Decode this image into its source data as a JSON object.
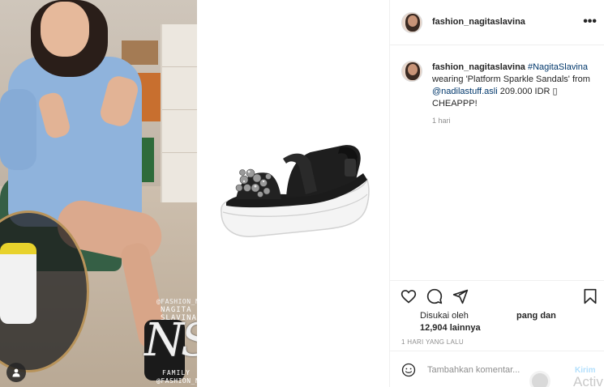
{
  "post": {
    "username": "fashion_nagitaslavina",
    "caption": {
      "username": "fashion_nagitaslavina",
      "hashtag": "#NagitaSlavina",
      "line1": " wearing 'Platform Sparkle Sandals' from ",
      "mention": "@nadilastuff.asli",
      "price": " 209.000 IDR ▯",
      "line2": "CHEAPPP!"
    },
    "caption_time": "1 hari",
    "likes": {
      "label": "Disukai oleh",
      "count": "12,904 lainnya",
      "names_text": "pang dan"
    },
    "post_time": "1 HARI YANG LALU",
    "more_icon": "more-options-icon"
  },
  "media": {
    "watermark_handle_top": "@FASHION_NAGITASLAVINA",
    "watermark_name": "NAGITA SLAVINA",
    "monogram": "NS",
    "watermark_family": "FAMILY",
    "watermark_handle_bottom": "@FASHION_NAGITASLAVINA"
  },
  "comment": {
    "placeholder": "Tambahkan komentar...",
    "send_label": "Kirim",
    "watermark": "Activ"
  },
  "icons": {
    "like": "heart-icon",
    "comment": "comment-icon",
    "share": "share-icon",
    "save": "bookmark-icon",
    "emoji": "emoji-icon",
    "tag": "user-tag-icon"
  }
}
